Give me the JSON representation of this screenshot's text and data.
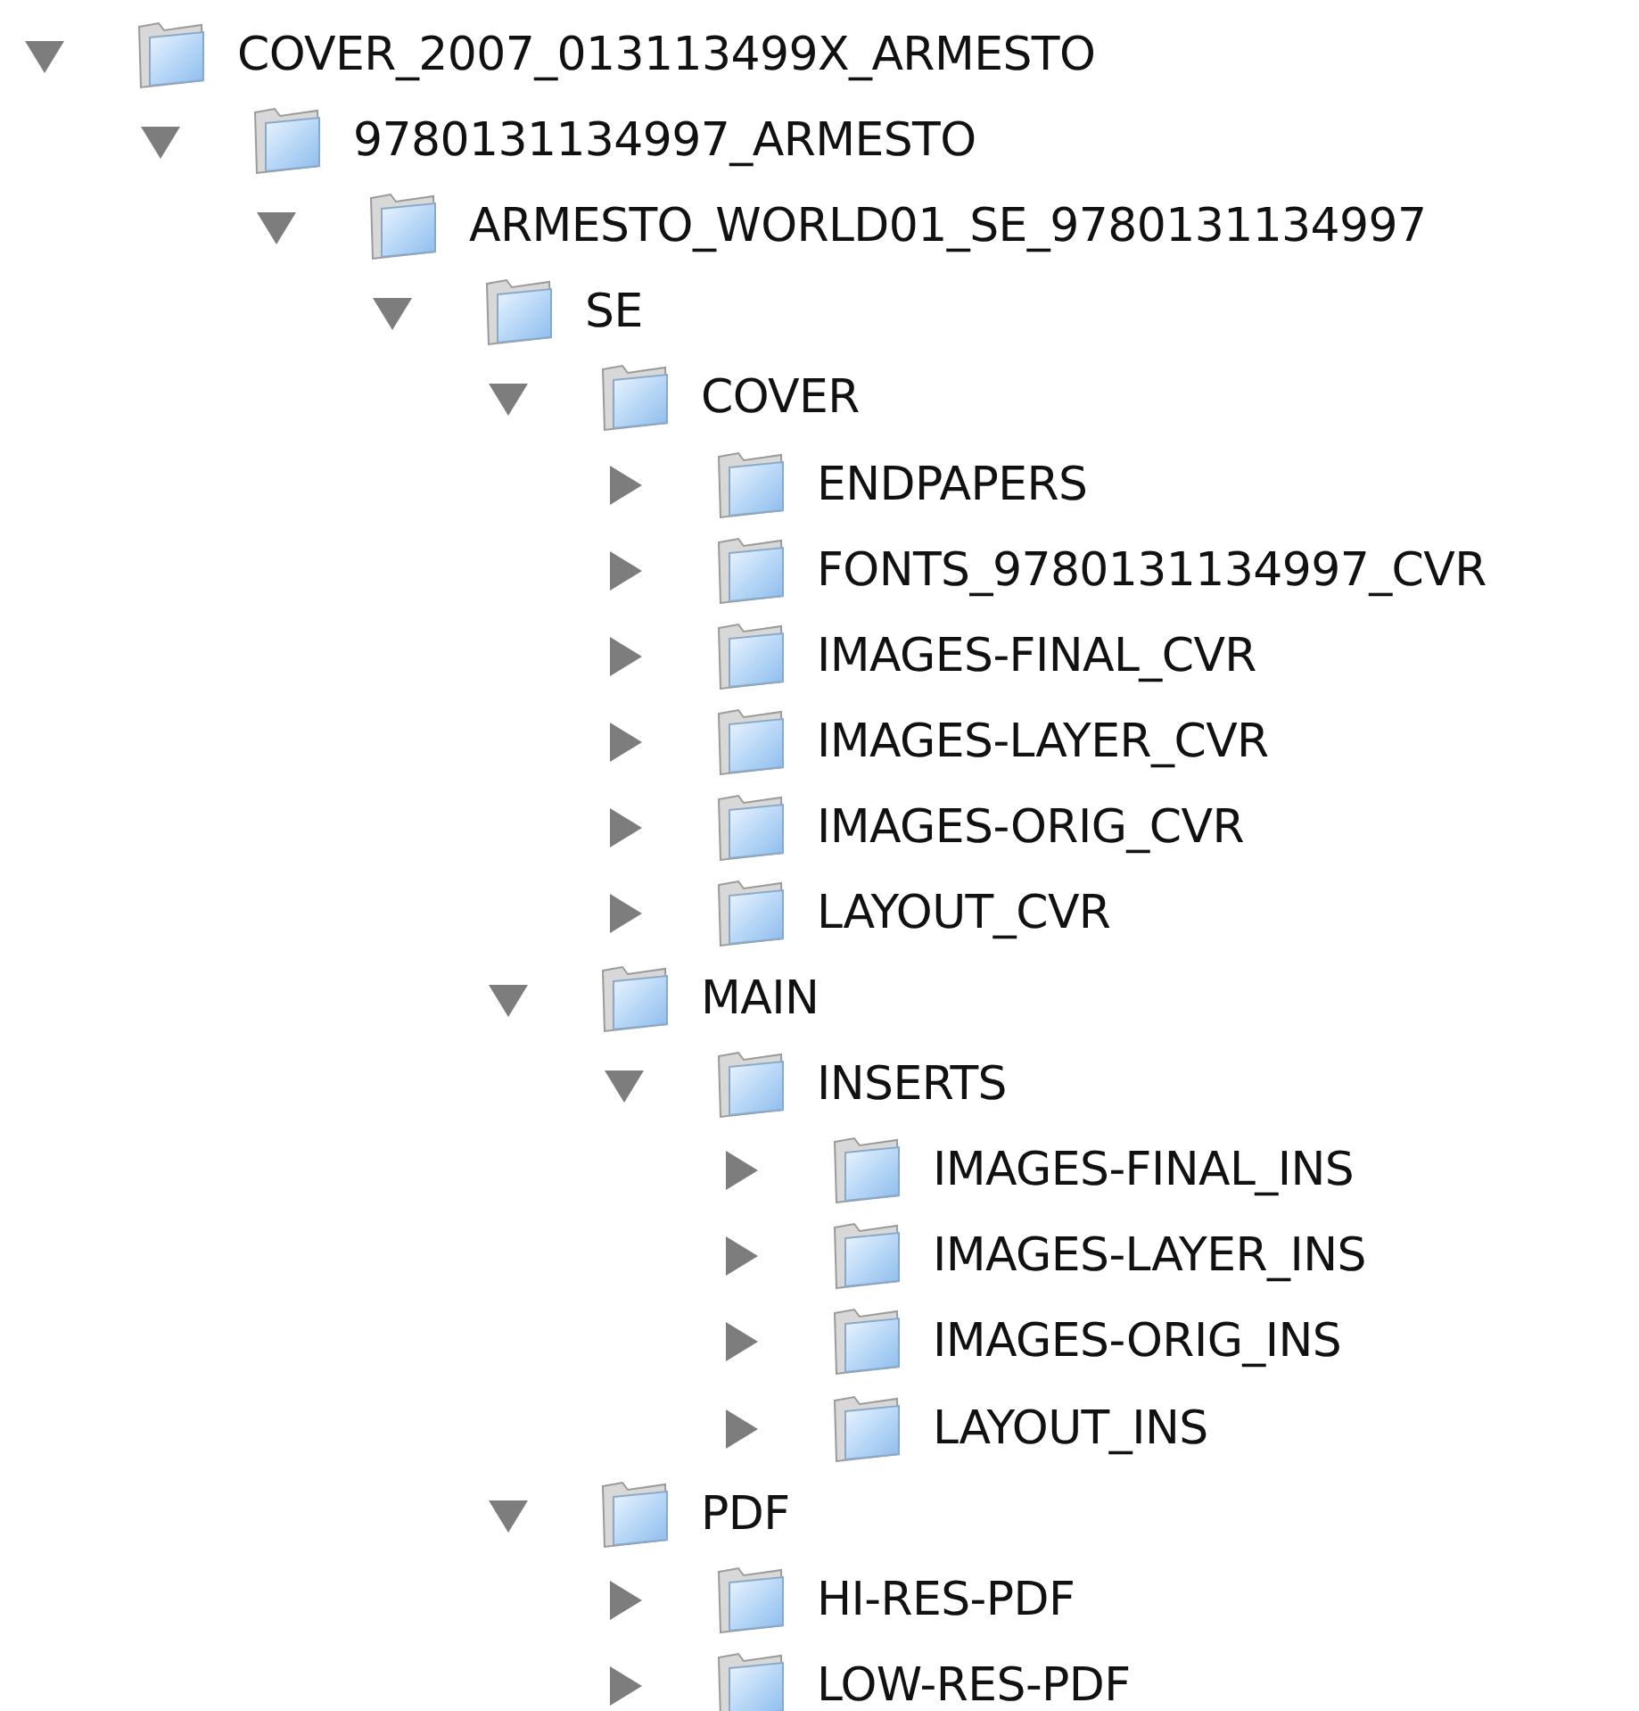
{
  "tree": [
    {
      "name": "COVER_2007_013113499X_ARMESTO",
      "expanded": true,
      "children": [
        {
          "name": "9780131134997_ARMESTO",
          "expanded": true,
          "children": [
            {
              "name": "ARMESTO_WORLD01_SE_9780131134997",
              "expanded": true,
              "children": [
                {
                  "name": "SE",
                  "expanded": true,
                  "children": [
                    {
                      "name": "COVER",
                      "expanded": true,
                      "children": [
                        {
                          "name": "ENDPAPERS",
                          "expanded": false
                        },
                        {
                          "name": "FONTS_9780131134997_CVR",
                          "expanded": false
                        },
                        {
                          "name": "IMAGES-FINAL_CVR",
                          "expanded": false
                        },
                        {
                          "name": "IMAGES-LAYER_CVR",
                          "expanded": false
                        },
                        {
                          "name": "IMAGES-ORIG_CVR",
                          "expanded": false
                        },
                        {
                          "name": "LAYOUT_CVR",
                          "expanded": false
                        }
                      ]
                    },
                    {
                      "name": "MAIN",
                      "expanded": true,
                      "children": [
                        {
                          "name": "INSERTS",
                          "expanded": true,
                          "children": [
                            {
                              "name": "IMAGES-FINAL_INS",
                              "expanded": false
                            },
                            {
                              "name": "IMAGES-LAYER_INS",
                              "expanded": false
                            },
                            {
                              "name": "IMAGES-ORIG_INS",
                              "expanded": false
                            },
                            {
                              "name": "LAYOUT_INS",
                              "expanded": false
                            }
                          ]
                        }
                      ]
                    },
                    {
                      "name": "PDF",
                      "expanded": true,
                      "children": [
                        {
                          "name": "HI-RES-PDF",
                          "expanded": false
                        },
                        {
                          "name": "LOW-RES-PDF",
                          "expanded": false
                        }
                      ]
                    }
                  ]
                }
              ]
            }
          ]
        }
      ]
    }
  ]
}
